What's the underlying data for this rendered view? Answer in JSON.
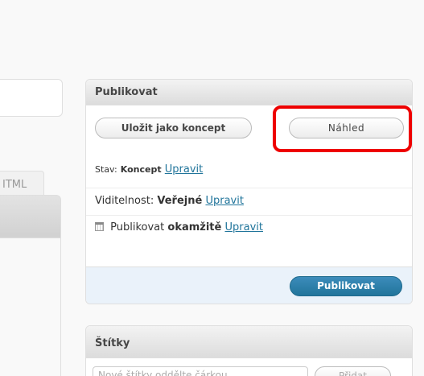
{
  "editor": {
    "html_tab": "ITML"
  },
  "publish_box": {
    "title": "Publikovat",
    "save_draft": "Uložit jako koncept",
    "preview": "Náhled",
    "status_label": "Stav:",
    "status_value": "Koncept",
    "edit_link": "Upravit",
    "visibility_label": "Viditelnost:",
    "visibility_value": "Veřejné",
    "publish_label": "Publikovat",
    "publish_when": "okamžitě",
    "publish_button": "Publikovat"
  },
  "tags_box": {
    "title": "Štítky",
    "input_placeholder": "Nové štítky oddělte čárkou",
    "add_button": "Přidat"
  },
  "colors": {
    "highlight": "#e00000",
    "link": "#21759b",
    "primary_button": "#21759b"
  }
}
